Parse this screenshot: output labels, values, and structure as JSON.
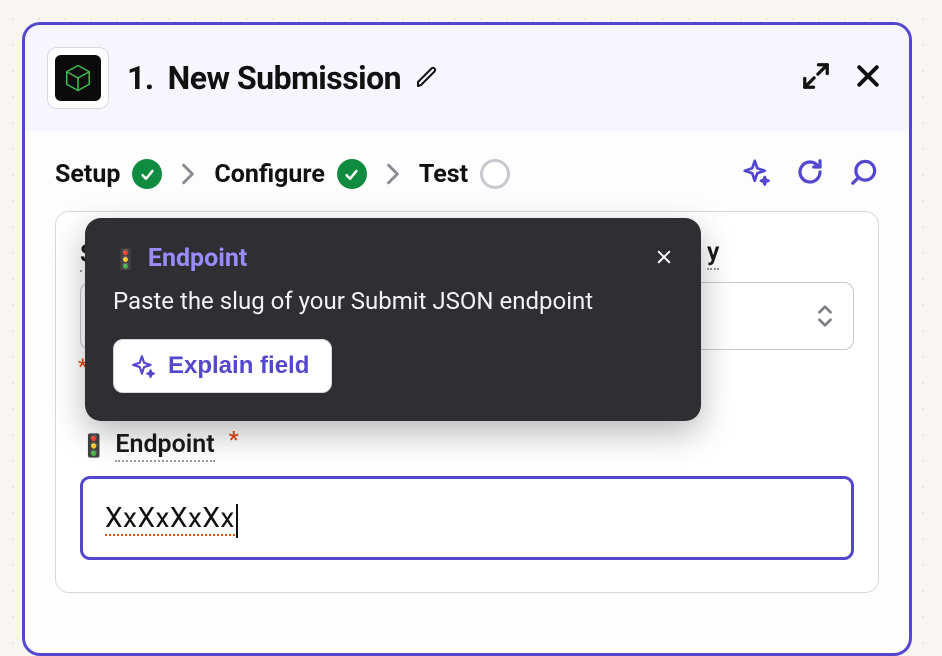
{
  "header": {
    "step_number": "1.",
    "title": "New Submission"
  },
  "stepper": {
    "steps": [
      {
        "label": "Setup",
        "status": "done"
      },
      {
        "label": "Configure",
        "status": "done"
      },
      {
        "label": "Test",
        "status": "pending"
      }
    ]
  },
  "card": {
    "first_field_label_initial": "S",
    "first_field_label_tail": "y",
    "required_marker": "*",
    "endpoint_emoji": "🚦",
    "endpoint_label": "Endpoint",
    "endpoint_value": "XxXxXxXx"
  },
  "popover": {
    "title_emoji": "🚦",
    "title": "Endpoint",
    "body": "Paste the slug of your Submit JSON endpoint",
    "explain_label": "Explain field"
  }
}
